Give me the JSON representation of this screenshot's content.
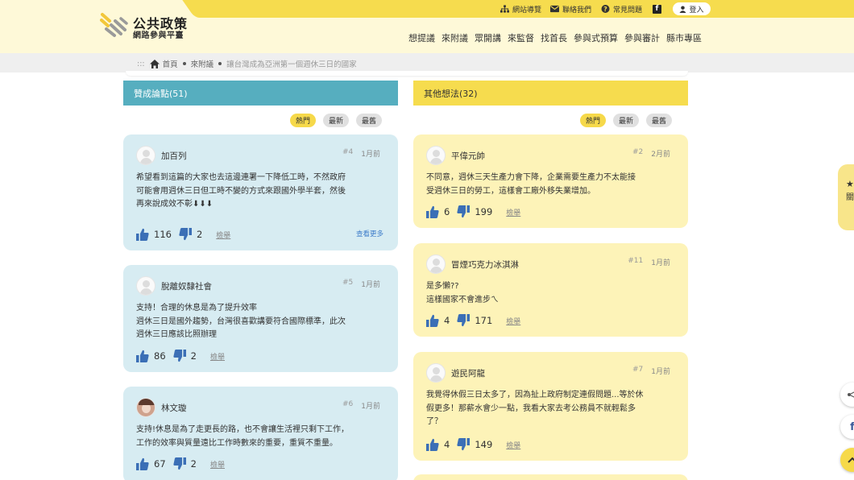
{
  "site": {
    "brand_main": "公共政策",
    "brand_sub": "網路參與平臺"
  },
  "topbar": {
    "sitemap": "網站導覽",
    "contact": "聯絡我們",
    "faq": "常見問題",
    "login": "登入"
  },
  "nav": [
    "想提議",
    "來附議",
    "眾開講",
    "來監督",
    "找首長",
    "參與式預算",
    "參與審計",
    "縣市專區"
  ],
  "breadcrumb": {
    "prefix": ":::",
    "home": "首頁",
    "section": "來附議",
    "current": "讓台灣成為亞洲第一個週休三日的國家"
  },
  "pro": {
    "heading": "贊成論點(51)",
    "sort": [
      "熱門",
      "最新",
      "最舊"
    ],
    "cards": [
      {
        "name": "加百列",
        "num": "#4",
        "time": "1月前",
        "text": "希望看到這篇的大家也去這邊連署一下降低工時，不然政府\n可能會用週休三日但工時不變的方式來跟國外學半套，然後\n再來說成效不彰⬇⬇⬇",
        "up": "116",
        "down": "2",
        "report": "檢舉",
        "more": "查看更多"
      },
      {
        "name": "脫離奴隸社會",
        "num": "#5",
        "time": "1月前",
        "text": "支持！合理的休息是為了提升效率\n週休三日是國外趨勢，台灣很喜歡講要符合國際標準，此次\n週休三日應該比照辦理",
        "up": "86",
        "down": "2",
        "report": "檢舉"
      },
      {
        "name": "林文璇",
        "num": "#6",
        "time": "1月前",
        "text": "支持!休息是為了走更長的路，也不會讓生活裡只剩下工作，\n工作的效率與質量遠比工作時數來的重要，重質不重量。",
        "up": "67",
        "down": "2",
        "report": "檢舉"
      }
    ]
  },
  "other": {
    "heading": "其他想法(32)",
    "sort": [
      "熱門",
      "最新",
      "最舊"
    ],
    "cards": [
      {
        "name": "平偉元帥",
        "num": "#2",
        "time": "2月前",
        "text": "不同意，週休三天生產力會下降，企業需要生產力不太能接\n受週休三日的勞工，這樣會工廠外移失業增加。",
        "up": "6",
        "down": "199",
        "report": "檢舉"
      },
      {
        "name": "冒煙巧克力冰淇淋",
        "num": "#11",
        "time": "1月前",
        "text": "是多懶??\n這樣國家不會進步ㄟ",
        "up": "4",
        "down": "171",
        "report": "檢舉"
      },
      {
        "name": "遊民阿龍",
        "num": "#7",
        "time": "1月前",
        "text": "我覺得休假三日太多了，因為扯上政府制定連假問題...等於休\n假更多！那薪水會少一點，我看大家去考公務員不就輕鬆多\n了？",
        "up": "4",
        "down": "149",
        "report": "檢舉"
      }
    ]
  },
  "side": {
    "tab_text": "關注",
    "share_icon": "share-icon",
    "fb_icon": "facebook-icon",
    "top_icon": "back-to-top-icon"
  },
  "colors": {
    "accent_yellow": "#f6dc4e",
    "pro_blue": "#56aebf",
    "card_blue": "#d7ecf2",
    "card_yellow": "#fdf3b8"
  }
}
